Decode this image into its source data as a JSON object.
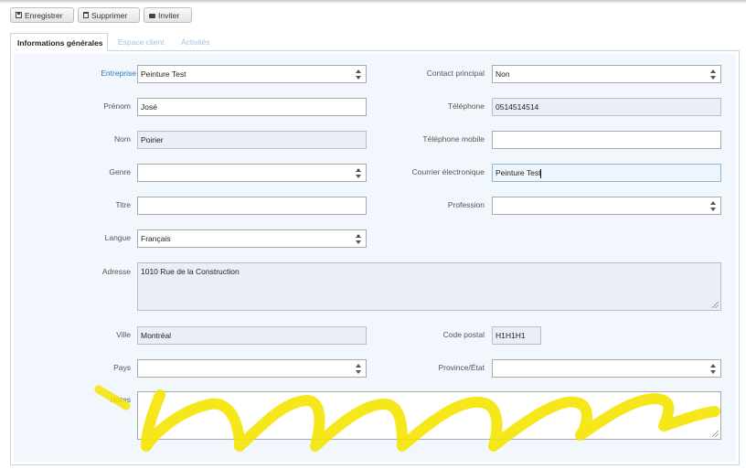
{
  "toolbar": {
    "save_label": "Enregistrer",
    "delete_label": "Supprimer",
    "invite_label": "Inviter"
  },
  "tabs": [
    {
      "label": "Informations générales",
      "active": true
    },
    {
      "label": "Espace client",
      "active": false
    },
    {
      "label": "Activités",
      "active": false
    }
  ],
  "form": {
    "company": {
      "label": "Entreprise",
      "value": "Peinture Test"
    },
    "main_contact": {
      "label": "Contact principal",
      "value": "Non"
    },
    "first_name": {
      "label": "Prénom",
      "value": "José"
    },
    "phone": {
      "label": "Téléphone",
      "value": "0514514514"
    },
    "last_name": {
      "label": "Nom",
      "value": "Poirier"
    },
    "mobile": {
      "label": "Téléphone mobile",
      "value": ""
    },
    "gender": {
      "label": "Genre",
      "value": ""
    },
    "email": {
      "label": "Courrier électronique",
      "value": "Peinture Test"
    },
    "title": {
      "label": "Titre",
      "value": ""
    },
    "profession": {
      "label": "Profession",
      "value": ""
    },
    "language": {
      "label": "Langue",
      "value": "Français"
    },
    "address": {
      "label": "Adresse",
      "value": "1010 Rue de la Construction"
    },
    "city": {
      "label": "Ville",
      "value": "Montréal"
    },
    "postal_code": {
      "label": "Code postal",
      "value": "H1H1H1"
    },
    "country": {
      "label": "Pays",
      "value": ""
    },
    "province": {
      "label": "Province/État",
      "value": ""
    },
    "notes": {
      "label": "Notes",
      "value": ""
    }
  },
  "colors": {
    "highlighter": "#f4e400",
    "link": "#2d7ab8",
    "form_background": "#f1f7fd"
  }
}
